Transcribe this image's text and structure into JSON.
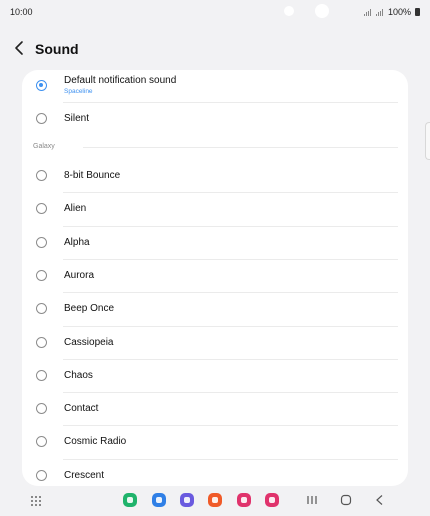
{
  "status": {
    "time": "10:00",
    "battery": "100%"
  },
  "header": {
    "title": "Sound"
  },
  "options": {
    "default": {
      "label": "Default notification sound",
      "sub": "Spaceline",
      "selected": true
    },
    "silent": {
      "label": "Silent"
    }
  },
  "section": {
    "label": "Galaxy"
  },
  "sounds": [
    "8-bit Bounce",
    "Alien",
    "Alpha",
    "Aurora",
    "Beep Once",
    "Cassiopeia",
    "Chaos",
    "Contact",
    "Cosmic Radio",
    "Crescent"
  ],
  "colors": {
    "accent": "#3e91f0",
    "page_bg": "#f2f2f4",
    "card_bg": "#ffffff"
  },
  "dock": [
    "phone-app-icon",
    "messages-app-icon",
    "internet-app-icon",
    "notes-app-icon",
    "gallery-app-icon",
    "camera-app-icon"
  ],
  "nav": [
    "recents-button",
    "home-button",
    "back-nav-button"
  ]
}
